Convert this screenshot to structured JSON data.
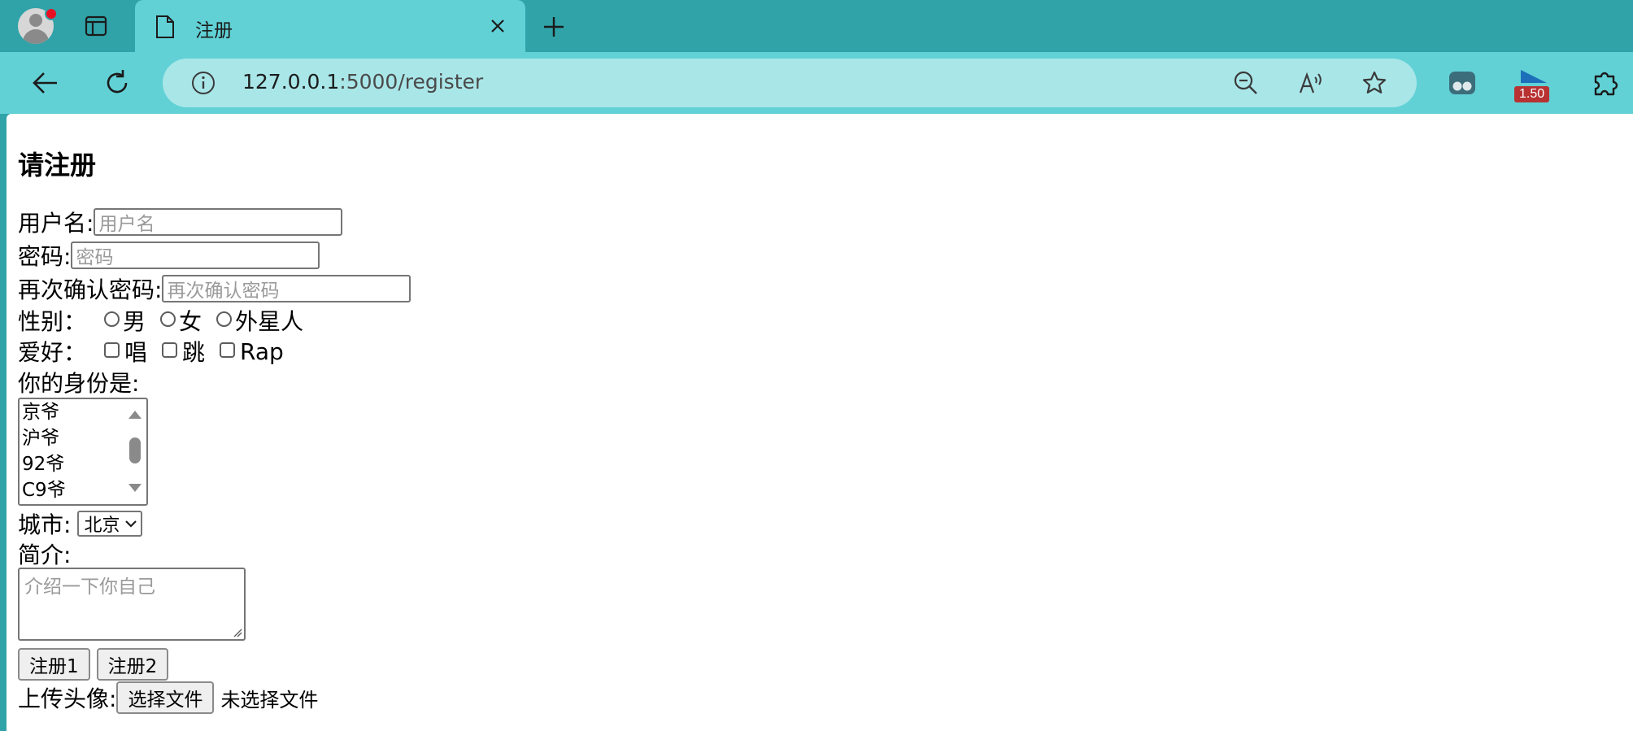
{
  "browser": {
    "tab": {
      "title": "注册"
    },
    "address": {
      "host": "127.0.0.1",
      "path": ":5000/register"
    },
    "extension_badge": "1.50"
  },
  "page": {
    "title": "请注册",
    "username": {
      "label": "用户名:",
      "placeholder": "用户名"
    },
    "password": {
      "label": "密码:",
      "placeholder": "密码"
    },
    "confirm": {
      "label": "再次确认密码:",
      "placeholder": "再次确认密码"
    },
    "gender": {
      "label": "性别：",
      "options": [
        "男",
        "女",
        "外星人"
      ]
    },
    "hobby": {
      "label": "爱好：",
      "options": [
        "唱",
        "跳",
        "Rap"
      ]
    },
    "identity": {
      "label": "你的身份是:",
      "options": [
        "京爷",
        "沪爷",
        "92爷",
        "C9爷"
      ]
    },
    "city": {
      "label": "城市:",
      "selected": "北京"
    },
    "intro": {
      "label": "简介:",
      "placeholder": "介绍一下你自己"
    },
    "buttons": {
      "register1": "注册1",
      "register2": "注册2"
    },
    "avatar": {
      "label": "上传头像:",
      "choose": "选择文件",
      "status": "未选择文件"
    }
  }
}
